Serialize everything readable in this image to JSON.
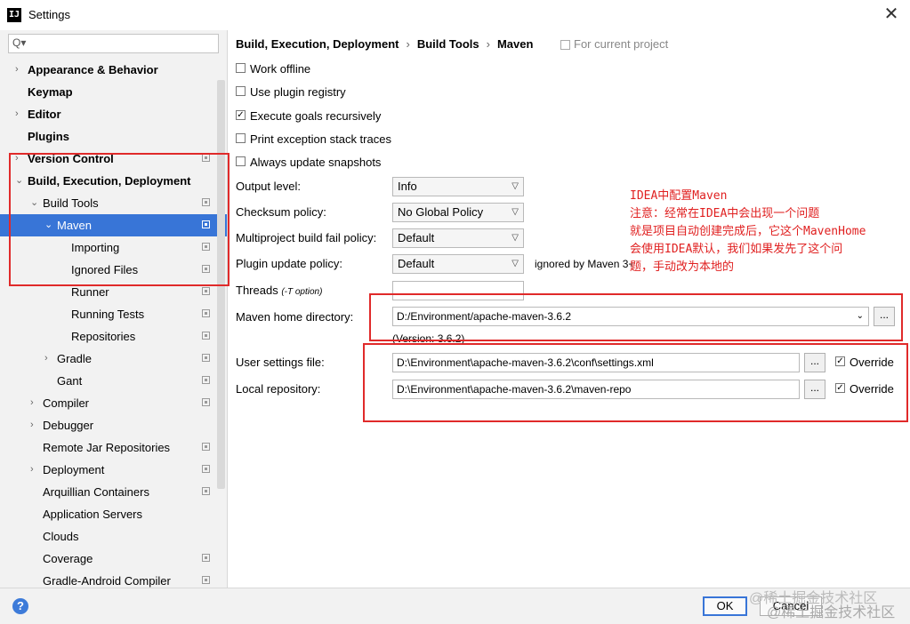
{
  "window": {
    "title": "Settings",
    "app_icon": "IJ",
    "close": "✕"
  },
  "search": {
    "value": "",
    "icon": "Q▾"
  },
  "sidebar": {
    "items": [
      {
        "label": "Appearance & Behavior",
        "arrow": "›",
        "bold": true
      },
      {
        "label": "Keymap",
        "bold": true
      },
      {
        "label": "Editor",
        "arrow": "›",
        "bold": true
      },
      {
        "label": "Plugins",
        "bold": true
      },
      {
        "label": "Version Control",
        "arrow": "›",
        "bold": true
      },
      {
        "label": "Build, Execution, Deployment",
        "arrow": "⌄",
        "bold": true
      },
      {
        "label": "Build Tools",
        "arrow": "⌄"
      },
      {
        "label": "Maven",
        "arrow": "⌄"
      },
      {
        "label": "Importing"
      },
      {
        "label": "Ignored Files"
      },
      {
        "label": "Runner"
      },
      {
        "label": "Running Tests"
      },
      {
        "label": "Repositories"
      },
      {
        "label": "Gradle",
        "arrow": "›"
      },
      {
        "label": "Gant"
      },
      {
        "label": "Compiler",
        "arrow": "›"
      },
      {
        "label": "Debugger",
        "arrow": "›"
      },
      {
        "label": "Remote Jar Repositories"
      },
      {
        "label": "Deployment",
        "arrow": "›"
      },
      {
        "label": "Arquillian Containers"
      },
      {
        "label": "Application Servers"
      },
      {
        "label": "Clouds"
      },
      {
        "label": "Coverage"
      },
      {
        "label": "Gradle-Android Compiler"
      }
    ]
  },
  "breadcrumb": {
    "part1": "Build, Execution, Deployment",
    "part2": "Build Tools",
    "part3": "Maven",
    "sep": "›",
    "scope": "For current project"
  },
  "options": {
    "work_offline": {
      "label": "Work offline",
      "checked": false
    },
    "plugin_registry": {
      "label": "Use plugin registry",
      "checked": false
    },
    "execute_goals": {
      "label": "Execute goals recursively",
      "checked": true
    },
    "print_exception": {
      "label": "Print exception stack traces",
      "checked": false
    },
    "update_snapshots": {
      "label": "Always update snapshots",
      "checked": false
    }
  },
  "form": {
    "output_level": {
      "label": "Output level:",
      "value": "Info"
    },
    "checksum_policy": {
      "label": "Checksum policy:",
      "value": "No Global Policy"
    },
    "multiproject_fail": {
      "label": "Multiproject build fail policy:",
      "value": "Default"
    },
    "plugin_update": {
      "label": "Plugin update policy:",
      "value": "Default",
      "note": "ignored by Maven 3+"
    },
    "threads": {
      "label": "Threads",
      "hint": "(-T option)",
      "value": ""
    },
    "maven_home": {
      "label": "Maven home directory:",
      "value": "D:/Environment/apache-maven-3.6.2",
      "version": "(Version: 3.6.2)"
    },
    "user_settings": {
      "label": "User settings file:",
      "value": "D:\\Environment\\apache-maven-3.6.2\\conf\\settings.xml",
      "override_label": "Override",
      "override_checked": true
    },
    "local_repo": {
      "label": "Local repository:",
      "value": "D:\\Environment\\apache-maven-3.6.2\\maven-repo",
      "override_label": "Override",
      "override_checked": true
    },
    "browse_label": "..."
  },
  "annotation": {
    "text": "IDEA中配置Maven\n注意：经常在IDEA中会出现一个问题\n就是项目自动创建完成后，它这个MavenHome\n会使用IDEA默认，我们如果发先了这个问\n题，手动改为本地的",
    "color": "#e02020"
  },
  "footer": {
    "ok_label": "OK",
    "cancel_label": "Cancel",
    "help": "?"
  },
  "watermark": {
    "line1": "@稀土掘金技术社区",
    "line2": "@稀土掘金技术社区"
  }
}
